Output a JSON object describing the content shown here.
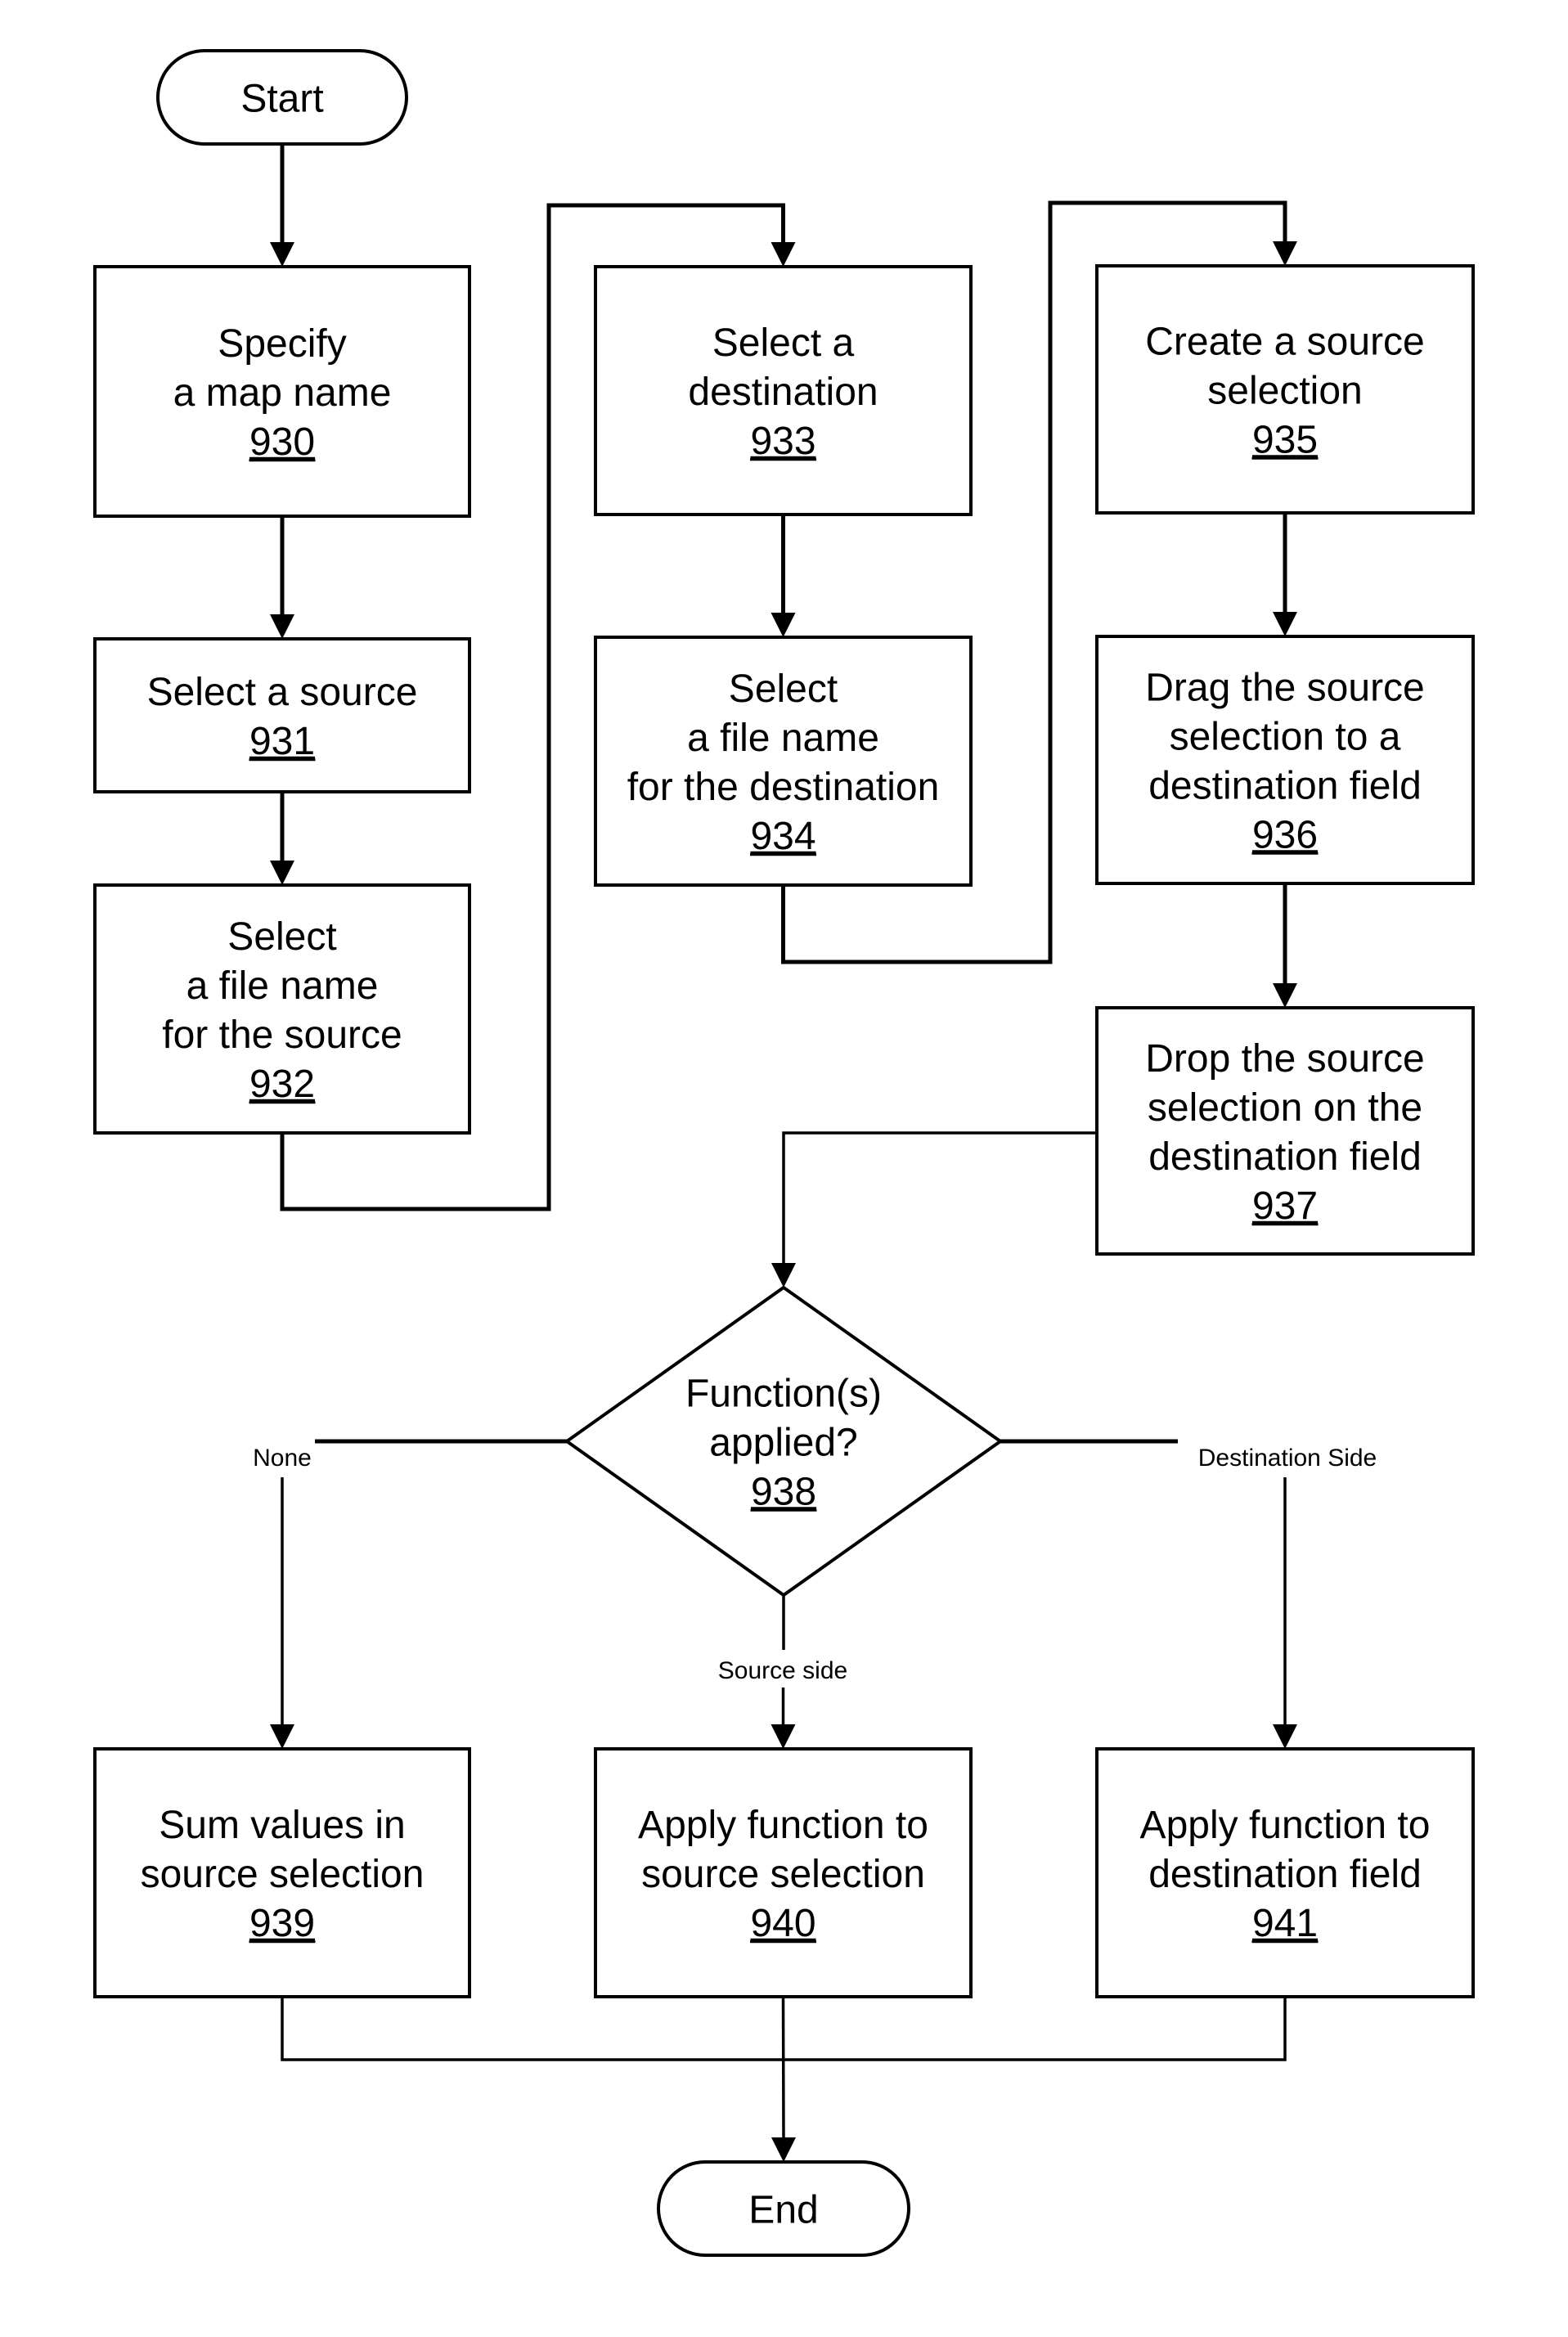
{
  "diagram": {
    "type": "flowchart",
    "colors": {
      "stroke": "#000000",
      "fill": "#ffffff",
      "text": "#000000"
    },
    "nodes": [
      {
        "id": "start",
        "shape": "terminal",
        "lines": [
          "Start"
        ],
        "ref": ""
      },
      {
        "id": "930",
        "shape": "process",
        "lines": [
          "Specify",
          "a map name"
        ],
        "ref": "930"
      },
      {
        "id": "931",
        "shape": "process",
        "lines": [
          "Select a source"
        ],
        "ref": "931"
      },
      {
        "id": "932",
        "shape": "process",
        "lines": [
          "Select",
          "a file name",
          "for the source"
        ],
        "ref": "932"
      },
      {
        "id": "933",
        "shape": "process",
        "lines": [
          "Select a",
          "destination"
        ],
        "ref": "933"
      },
      {
        "id": "934",
        "shape": "process",
        "lines": [
          "Select",
          "a file name",
          "for the destination"
        ],
        "ref": "934"
      },
      {
        "id": "935",
        "shape": "process",
        "lines": [
          "Create a source",
          "selection"
        ],
        "ref": "935"
      },
      {
        "id": "936",
        "shape": "process",
        "lines": [
          "Drag the source",
          "selection to a",
          "destination field"
        ],
        "ref": "936"
      },
      {
        "id": "937",
        "shape": "process",
        "lines": [
          "Drop the source",
          "selection on the",
          "destination field"
        ],
        "ref": "937"
      },
      {
        "id": "938",
        "shape": "decision",
        "lines": [
          "Function(s)",
          "applied?"
        ],
        "ref": "938"
      },
      {
        "id": "939",
        "shape": "process",
        "lines": [
          "Sum values in",
          "source selection"
        ],
        "ref": "939"
      },
      {
        "id": "940",
        "shape": "process",
        "lines": [
          "Apply function to",
          "source selection"
        ],
        "ref": "940"
      },
      {
        "id": "941",
        "shape": "process",
        "lines": [
          "Apply function to",
          "destination field"
        ],
        "ref": "941"
      },
      {
        "id": "end",
        "shape": "terminal",
        "lines": [
          "End"
        ],
        "ref": ""
      }
    ],
    "edges": [
      {
        "from": "start",
        "to": "930",
        "label": ""
      },
      {
        "from": "930",
        "to": "931",
        "label": ""
      },
      {
        "from": "931",
        "to": "932",
        "label": ""
      },
      {
        "from": "932",
        "to": "933",
        "label": ""
      },
      {
        "from": "933",
        "to": "934",
        "label": ""
      },
      {
        "from": "934",
        "to": "935",
        "label": ""
      },
      {
        "from": "935",
        "to": "936",
        "label": ""
      },
      {
        "from": "936",
        "to": "937",
        "label": ""
      },
      {
        "from": "937",
        "to": "938",
        "label": ""
      },
      {
        "from": "938",
        "to": "939",
        "label": "None"
      },
      {
        "from": "938",
        "to": "940",
        "label": "Source side"
      },
      {
        "from": "938",
        "to": "941",
        "label": "Destination Side"
      },
      {
        "from": "939",
        "to": "end",
        "label": ""
      },
      {
        "from": "940",
        "to": "end",
        "label": ""
      },
      {
        "from": "941",
        "to": "end",
        "label": ""
      }
    ]
  }
}
